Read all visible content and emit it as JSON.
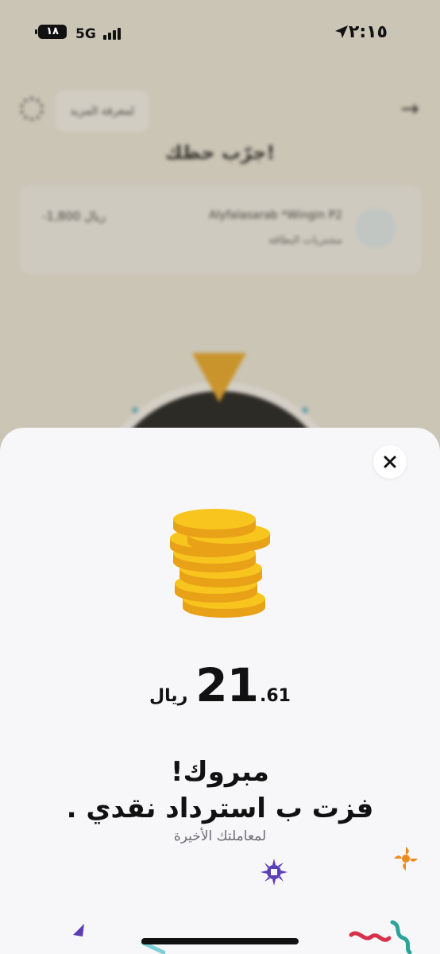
{
  "status_bar": {
    "time": "٢:١٥",
    "network": "5G",
    "battery": "١٨"
  },
  "background": {
    "more_button": "لمعرفة المزيد",
    "title": "جرّب حظك!",
    "merchant": {
      "name": "Alyfalasarab *Wingin P2",
      "subtitle": "مشتريات البطاقة",
      "amount": "-1,800 ريال"
    }
  },
  "sheet": {
    "amount": {
      "currency": "ريال",
      "integer": "21",
      "decimal": ".61"
    },
    "congrats_line1": "مبروك!",
    "congrats_line2": "فزت ب استرداد نقدي .",
    "subtitle": "لمعاملتك الأخيرة"
  },
  "colors": {
    "coin_gold": "#f7c51d",
    "coin_edge": "#e9a218",
    "sheet_bg": "#f7f7f9",
    "confetti_purple": "#5b3db8",
    "confetti_orange": "#f08a1c",
    "confetti_red": "#d6304a",
    "confetti_teal": "#2aa39a"
  },
  "icons": {
    "close": "close-icon",
    "coins": "coins-stack-icon",
    "location": "location-arrow-icon"
  }
}
